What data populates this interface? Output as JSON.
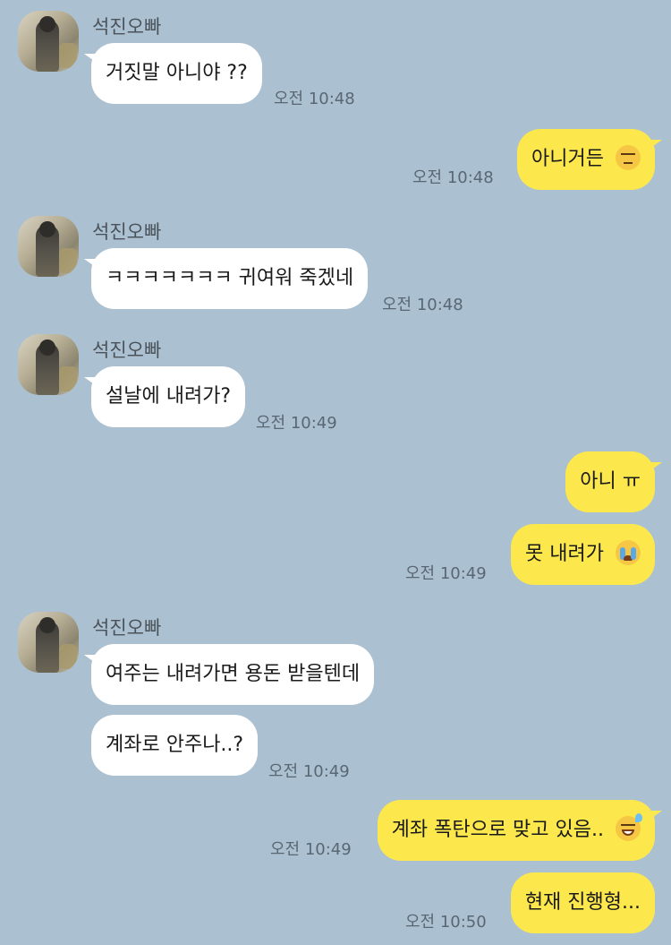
{
  "chat": {
    "contact_name": "석진오빠",
    "messages": [
      {
        "from": "them",
        "text": "거짓말 아니야 ??",
        "time": "오전 10:48"
      },
      {
        "from": "me",
        "text": "아니거든",
        "emoji": "expressionless-face",
        "time": "오전 10:48"
      },
      {
        "from": "them",
        "text": "ㅋㅋㅋㅋㅋㅋㅋ 귀여워 죽겠네",
        "time": "오전 10:48"
      },
      {
        "from": "them",
        "text": "설날에 내려가?",
        "time": "오전 10:49"
      },
      {
        "from": "me",
        "text": "아니 ㅠ"
      },
      {
        "from": "me",
        "text": "못 내려가",
        "emoji": "loudly-crying-face",
        "time": "오전 10:49"
      },
      {
        "from": "them",
        "text": "여주는 내려가면 용돈 받을텐데"
      },
      {
        "from": "them",
        "text": "계좌로 안주나..?",
        "time": "오전 10:49"
      },
      {
        "from": "me",
        "text": "계좌 폭탄으로 맞고 있음..",
        "emoji": "grinning-face-with-sweat",
        "time": "오전 10:49"
      },
      {
        "from": "me",
        "text": "현재 진행형...",
        "time": "오전 10:50"
      }
    ]
  },
  "colors": {
    "background": "#abc1d1",
    "incoming_bubble": "#ffffff",
    "outgoing_bubble": "#fce84d"
  }
}
